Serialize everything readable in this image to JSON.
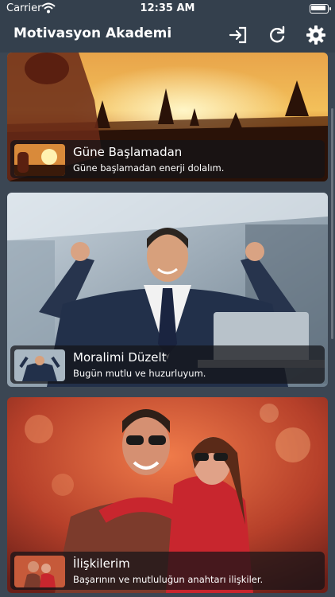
{
  "statusbar": {
    "carrier": "Carrier",
    "time": "12:35 AM"
  },
  "navbar": {
    "title": "Motivasyon Akademi",
    "icons": [
      "logout-icon",
      "refresh-icon",
      "settings-icon"
    ]
  },
  "cards": [
    {
      "title": "Güne Başlamadan",
      "subtitle": "Güne başlamadan enerji dolalım."
    },
    {
      "title": "Moralimi Düzelt",
      "subtitle": "Bugün mutlu ve huzurluyum."
    },
    {
      "title": "İlişkilerim",
      "subtitle": "Başarının ve mutluluğun anahtarı ilişkiler."
    }
  ],
  "colors": {
    "navbar_bg": "#34404d",
    "page_bg": "#3b4653",
    "caption_bg": "rgba(20,20,24,0.72)"
  }
}
